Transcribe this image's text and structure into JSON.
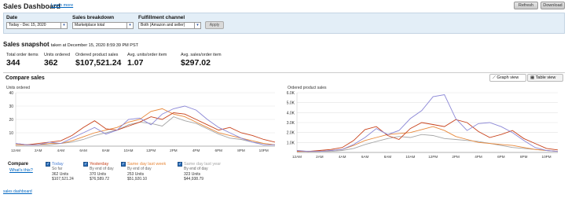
{
  "header": {
    "title": "Sales Dashboard",
    "learn_more": "Learn more",
    "refresh": "Refresh",
    "download": "Download"
  },
  "filters": {
    "date_label": "Date",
    "date_value": "Today - Dec 15, 2020",
    "breakdown_label": "Sales breakdown",
    "breakdown_value": "Marketplace total",
    "fulfillment_label": "Fulfillment channel",
    "fulfillment_value": "Both (Amazon and seller)",
    "apply": "Apply"
  },
  "snapshot": {
    "title": "Sales snapshot",
    "taken_at": "taken at December 15, 2020 8:59:39 PM PST",
    "metrics": [
      {
        "label": "Total order items",
        "value": "344"
      },
      {
        "label": "Units ordered",
        "value": "362"
      },
      {
        "label": "Ordered product sales",
        "value": "$107,521.24"
      },
      {
        "label": "Avg. units/order item",
        "value": "1.07"
      },
      {
        "label": "Avg. sales/order item",
        "value": "$297.02"
      }
    ]
  },
  "compare": {
    "title": "Compare sales",
    "graph_view": "Graph view",
    "table_view": "Table view",
    "compare_label": "Compare",
    "whats_this": "What's this?",
    "legend": [
      {
        "name": "Today",
        "sub": "So far",
        "units": "362 Units",
        "sales": "$107,521.24",
        "color": "#4a7fd4"
      },
      {
        "name": "Yesterday",
        "sub": "By end of day",
        "units": "370 Units",
        "sales": "$76,589.72",
        "color": "#c8421b"
      },
      {
        "name": "Same day last week",
        "sub": "By end of day",
        "units": "253 Units",
        "sales": "$51,920.10",
        "color": "#e8883a"
      },
      {
        "name": "Same day last year",
        "sub": "By end of day",
        "units": "323 Units",
        "sales": "$44,938.79",
        "color": "#a6a6a6"
      }
    ]
  },
  "footer": {
    "link": "sales dashboard"
  },
  "chart_data": [
    {
      "type": "line",
      "title": "",
      "ylabel": "Units ordered",
      "ylim": [
        0,
        40
      ],
      "yticks": [
        "40",
        "30",
        "20",
        "10"
      ],
      "xticks": [
        "12AM",
        "2AM",
        "4AM",
        "6AM",
        "8AM",
        "10AM",
        "12PM",
        "2PM",
        "4PM",
        "6PM",
        "8PM",
        "10PM"
      ],
      "x": [
        0,
        1,
        2,
        3,
        4,
        5,
        6,
        7,
        8,
        9,
        10,
        11,
        12,
        13,
        14,
        15,
        16,
        17,
        18,
        19,
        20,
        21,
        22,
        23
      ],
      "series": [
        {
          "name": "Today",
          "color": "#8b87d6",
          "values": [
            2,
            1,
            1,
            3,
            2,
            6,
            10,
            14,
            9,
            12,
            20,
            21,
            16,
            24,
            28,
            30,
            27,
            20,
            14,
            10,
            6,
            3,
            1,
            1
          ]
        },
        {
          "name": "Yesterday",
          "color": "#c8421b",
          "values": [
            2,
            1,
            2,
            3,
            4,
            8,
            14,
            19,
            13,
            12,
            15,
            18,
            22,
            20,
            25,
            24,
            20,
            16,
            12,
            14,
            10,
            8,
            5,
            3
          ]
        },
        {
          "name": "Same day last week",
          "color": "#e8883a",
          "values": [
            1,
            1,
            1,
            2,
            2,
            4,
            7,
            10,
            12,
            14,
            18,
            20,
            26,
            28,
            24,
            22,
            18,
            14,
            10,
            8,
            6,
            4,
            2,
            1
          ]
        },
        {
          "name": "Same day last year",
          "color": "#a6a6a6",
          "values": [
            1,
            1,
            1,
            1,
            2,
            3,
            5,
            8,
            10,
            12,
            16,
            18,
            17,
            15,
            22,
            19,
            17,
            13,
            9,
            6,
            5,
            3,
            2,
            1
          ]
        }
      ]
    },
    {
      "type": "line",
      "title": "",
      "ylabel": "Ordered product sales",
      "ylim": [
        0,
        6000
      ],
      "yticks": [
        "6.0K",
        "5.0K",
        "4.0K",
        "3.0K",
        "2.0K",
        "1.0K"
      ],
      "xticks": [
        "12AM",
        "2AM",
        "4AM",
        "6AM",
        "8AM",
        "10AM",
        "12PM",
        "2PM",
        "4PM",
        "6PM",
        "8PM",
        "10PM"
      ],
      "x": [
        0,
        1,
        2,
        3,
        4,
        5,
        6,
        7,
        8,
        9,
        10,
        11,
        12,
        13,
        14,
        15,
        16,
        17,
        18,
        19,
        20,
        21,
        22,
        23
      ],
      "series": [
        {
          "name": "Today",
          "color": "#8b87d6",
          "values": [
            200,
            100,
            100,
            200,
            300,
            800,
            1500,
            2400,
            1800,
            2200,
            3400,
            4200,
            5600,
            5800,
            3400,
            2200,
            2900,
            3000,
            2600,
            2000,
            1200,
            500,
            200,
            100
          ]
        },
        {
          "name": "Yesterday",
          "color": "#c8421b",
          "values": [
            150,
            100,
            200,
            300,
            500,
            1200,
            2300,
            2600,
            1700,
            1300,
            2400,
            3000,
            2800,
            2600,
            3300,
            3000,
            2100,
            1500,
            1800,
            2200,
            1400,
            900,
            400,
            250
          ]
        },
        {
          "name": "Same day last week",
          "color": "#e8883a",
          "values": [
            100,
            100,
            100,
            200,
            300,
            700,
            1200,
            1500,
            1800,
            1900,
            2000,
            2300,
            2600,
            2200,
            1600,
            1300,
            1000,
            900,
            800,
            700,
            500,
            300,
            200,
            100
          ]
        },
        {
          "name": "Same day last year",
          "color": "#a6a6a6",
          "values": [
            100,
            100,
            100,
            100,
            200,
            400,
            800,
            1100,
            1400,
            1600,
            1500,
            1800,
            1700,
            1400,
            1300,
            1200,
            1100,
            900,
            700,
            500,
            400,
            300,
            200,
            100
          ]
        }
      ]
    }
  ]
}
